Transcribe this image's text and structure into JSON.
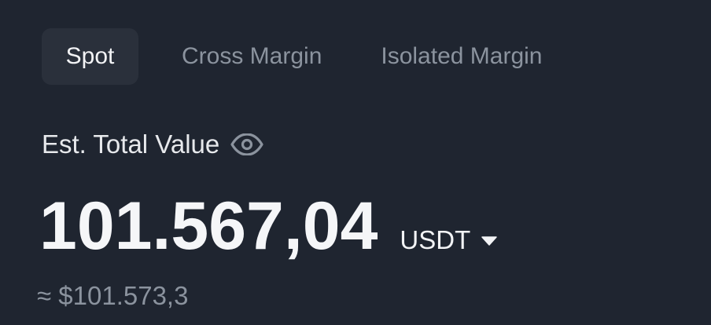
{
  "tabs": [
    {
      "label": "Spot",
      "active": true
    },
    {
      "label": "Cross Margin",
      "active": false
    },
    {
      "label": "Isolated Margin",
      "active": false
    }
  ],
  "balance": {
    "label": "Est. Total Value",
    "visibility_icon": "eye-icon",
    "value": "101.567,04",
    "currency": "USDT",
    "currency_icon": "caret-down-icon",
    "approx_usd": "≈ $101.573,3"
  },
  "colors": {
    "background": "#1f2530",
    "active_tab_bg": "#2a303b",
    "primary_text": "#eaecef",
    "secondary_text": "#8b939e"
  }
}
